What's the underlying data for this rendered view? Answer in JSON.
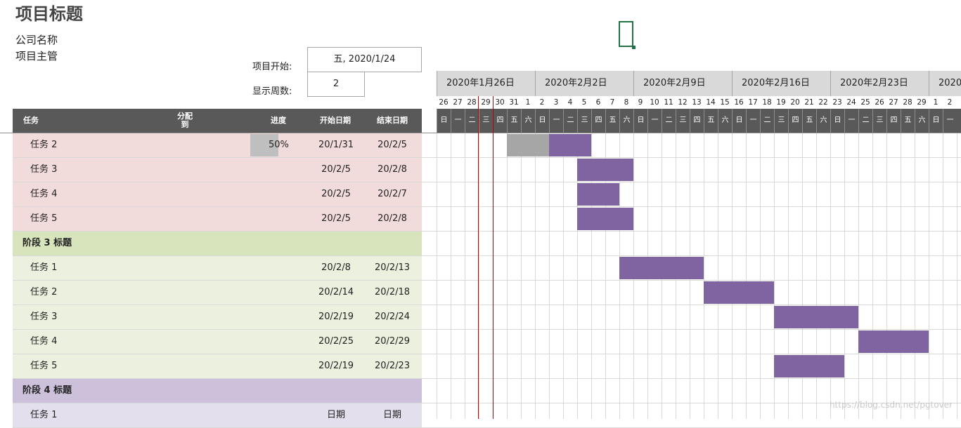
{
  "title": "项目标题",
  "company": "公司名称",
  "manager": "项目主管",
  "start_label": "项目开始:",
  "start_value": "五, 2020/1/24",
  "weeks_label": "显示周数:",
  "weeks_value": "2",
  "columns": {
    "task": "任务",
    "assign": "分配\n到",
    "progress": "进度",
    "start": "开始日期",
    "end": "结束日期"
  },
  "weeks": [
    "2020年1月26日",
    "2020年2月2日",
    "2020年2月9日",
    "2020年2月16日",
    "2020年2月23日",
    "2020"
  ],
  "day_numbers": [
    "26",
    "27",
    "28",
    "29",
    "30",
    "31",
    "1",
    "2",
    "3",
    "4",
    "5",
    "6",
    "7",
    "8",
    "9",
    "10",
    "11",
    "12",
    "13",
    "14",
    "15",
    "16",
    "17",
    "18",
    "19",
    "20",
    "21",
    "22",
    "23",
    "24",
    "25",
    "26",
    "27",
    "28",
    "29",
    "1",
    "2"
  ],
  "day_names": [
    "日",
    "一",
    "二",
    "三",
    "四",
    "五",
    "六",
    "日",
    "一",
    "二",
    "三",
    "四",
    "五",
    "六",
    "日",
    "一",
    "二",
    "三",
    "四",
    "五",
    "六",
    "日",
    "一",
    "二",
    "三",
    "四",
    "五",
    "六",
    "日",
    "一",
    "二",
    "三",
    "四",
    "五",
    "六",
    "日",
    "一"
  ],
  "rows": [
    {
      "kind": "task",
      "phase": 2,
      "name": "任务 2",
      "progress": "50%",
      "progress_value": 0.5,
      "start": "20/1/31",
      "end": "20/2/5"
    },
    {
      "kind": "task",
      "phase": 2,
      "name": "任务 3",
      "progress": "",
      "start": "20/2/5",
      "end": "20/2/8"
    },
    {
      "kind": "task",
      "phase": 2,
      "name": "任务 4",
      "progress": "",
      "start": "20/2/5",
      "end": "20/2/7"
    },
    {
      "kind": "task",
      "phase": 2,
      "name": "任务 5",
      "progress": "",
      "start": "20/2/5",
      "end": "20/2/8"
    },
    {
      "kind": "phase",
      "phase": 3,
      "name": "阶段 3 标题"
    },
    {
      "kind": "task",
      "phase": 3,
      "name": "任务 1",
      "progress": "",
      "start": "20/2/8",
      "end": "20/2/13"
    },
    {
      "kind": "task",
      "phase": 3,
      "name": "任务 2",
      "progress": "",
      "start": "20/2/14",
      "end": "20/2/18"
    },
    {
      "kind": "task",
      "phase": 3,
      "name": "任务 3",
      "progress": "",
      "start": "20/2/19",
      "end": "20/2/24"
    },
    {
      "kind": "task",
      "phase": 3,
      "name": "任务 4",
      "progress": "",
      "start": "20/2/25",
      "end": "20/2/29"
    },
    {
      "kind": "task",
      "phase": 3,
      "name": "任务 5",
      "progress": "",
      "start": "20/2/19",
      "end": "20/2/23"
    },
    {
      "kind": "phase",
      "phase": 4,
      "name": "阶段 4 标题"
    },
    {
      "kind": "task",
      "phase": 4,
      "name": "任务 1",
      "progress": "",
      "start": "日期",
      "end": "日期"
    }
  ],
  "gantt_bars": [
    {
      "row": 0,
      "done_from": "2020-01-31",
      "done_days": 3,
      "todo_days": 3
    },
    {
      "row": 1,
      "done_from": "2020-02-05",
      "done_days": 0,
      "todo_days": 4
    },
    {
      "row": 2,
      "done_from": "2020-02-05",
      "done_days": 0,
      "todo_days": 3
    },
    {
      "row": 3,
      "done_from": "2020-02-05",
      "done_days": 0,
      "todo_days": 4
    },
    {
      "row": 5,
      "done_from": "2020-02-08",
      "done_days": 0,
      "todo_days": 6
    },
    {
      "row": 6,
      "done_from": "2020-02-14",
      "done_days": 0,
      "todo_days": 5
    },
    {
      "row": 7,
      "done_from": "2020-02-19",
      "done_days": 0,
      "todo_days": 6
    },
    {
      "row": 8,
      "done_from": "2020-02-25",
      "done_days": 0,
      "todo_days": 5
    },
    {
      "row": 9,
      "done_from": "2020-02-19",
      "done_days": 0,
      "todo_days": 5
    }
  ],
  "colors": {
    "phase2_bg": "#f2dcdb",
    "phase3_bg": "#ebf1de",
    "phase3_header": "#d8e4bc",
    "phase4_header": "#ccc0da",
    "phase4_bg": "#e4dfec",
    "bar": "#8064a2",
    "bar_done": "#a6a6a6",
    "header": "#595959",
    "today": "#c00000"
  },
  "watermark": "https://blog.csdn.net/pgtover"
}
